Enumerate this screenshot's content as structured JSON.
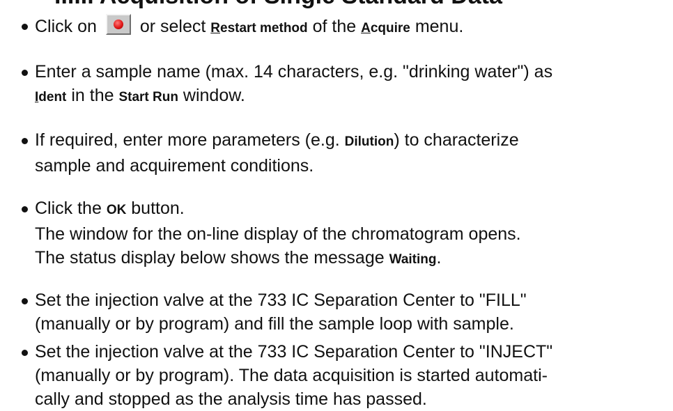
{
  "heading": "...... Acquisition of Single Standard Data",
  "steps": [
    {
      "p1": "Click on",
      "p2": "or select",
      "k1a": "R",
      "k1b": "estart method",
      "p3": "of the",
      "k2a": "A",
      "k2b": "cquire",
      "p4": "menu."
    },
    {
      "line1": "Enter a sample name (max. 14 characters, e.g. \"drinking water\") as",
      "k1a": "I",
      "k1b": "dent",
      "p2": "in the",
      "k2": "Start Run",
      "p3": "window."
    },
    {
      "p1": "If required, enter more parameters (e.g.",
      "k1": "Dilution",
      "p2": ") to characterize",
      "line2": "sample and acquirement conditions."
    },
    {
      "p1": "Click the",
      "k1": "OK",
      "p2": "button.",
      "line2": "The window for the on-line display of the chromatogram opens.",
      "p3": "The status display below shows the message",
      "k2": "Waiting",
      "p4": "."
    },
    {
      "line1": "Set the injection valve at the 733 IC Separation Center to \"FILL\"",
      "line2": "(manually or by program) and fill the sample loop with sample."
    },
    {
      "line1": "Set the injection valve at the 733 IC Separation Center to \"INJECT\"",
      "line2": "(manually or by program). The data acquisition is started automati-",
      "line3": "cally and stopped as the analysis time has passed."
    }
  ],
  "icons": {
    "restart_button": "record-red-dot-icon"
  }
}
